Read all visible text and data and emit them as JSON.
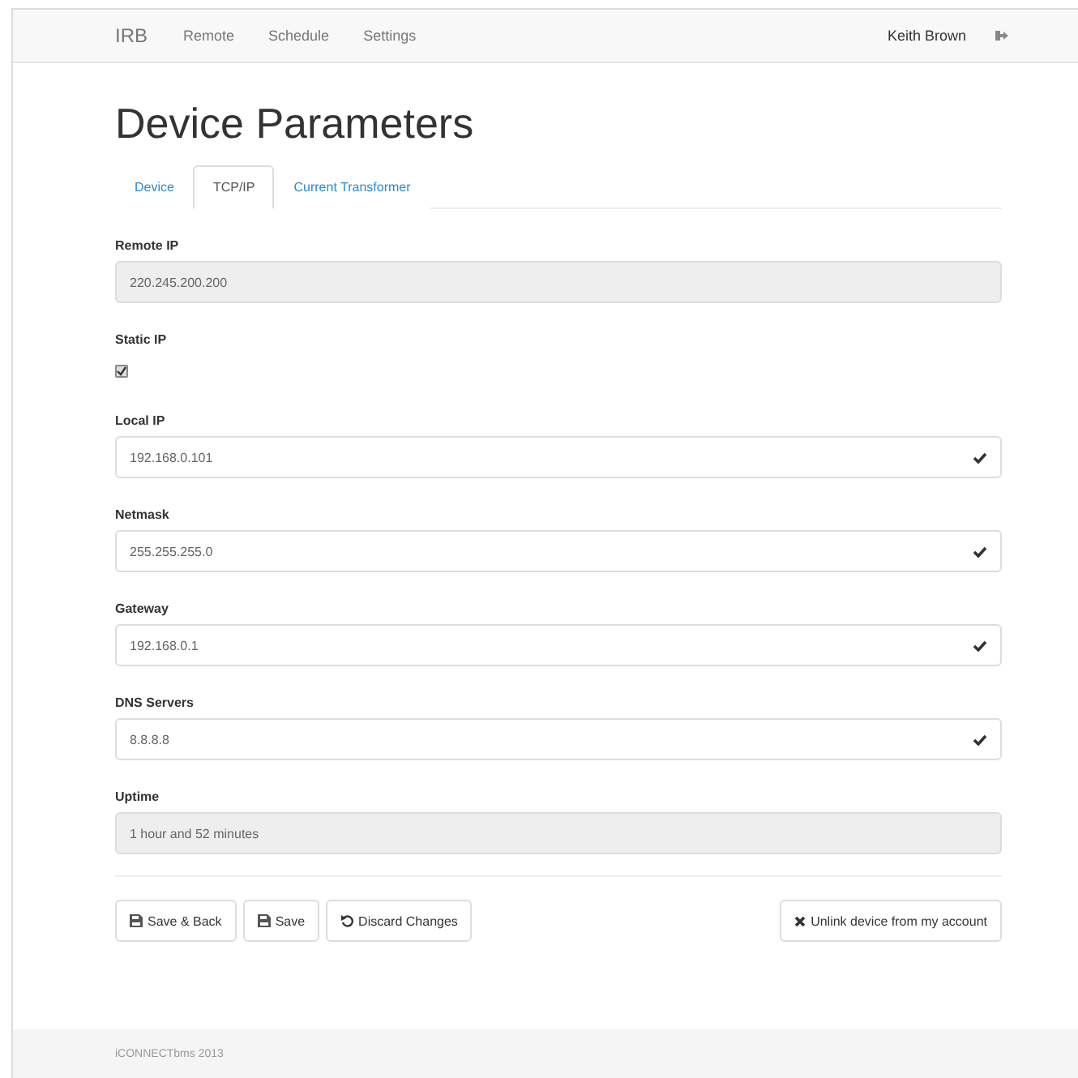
{
  "navbar": {
    "brand": "IRB",
    "links": [
      "Remote",
      "Schedule",
      "Settings"
    ],
    "user": "Keith Brown"
  },
  "title": "Device Parameters",
  "tabs": [
    {
      "label": "Device",
      "selected": false
    },
    {
      "label": "TCP/IP",
      "selected": true
    },
    {
      "label": "Current Transformer",
      "selected": false
    }
  ],
  "fields": [
    {
      "kind": "readonly",
      "label": "Remote IP",
      "value": "220.245.200.200"
    },
    {
      "kind": "checkbox",
      "label": "Static IP",
      "checked": true
    },
    {
      "kind": "valid",
      "label": "Local IP",
      "value": "192.168.0.101"
    },
    {
      "kind": "valid",
      "label": "Netmask",
      "value": "255.255.255.0"
    },
    {
      "kind": "valid",
      "label": "Gateway",
      "value": "192.168.0.1"
    },
    {
      "kind": "valid",
      "label": "DNS Servers",
      "value": "8.8.8.8"
    },
    {
      "kind": "readonly",
      "label": "Uptime",
      "value": "1 hour and 52 minutes"
    }
  ],
  "buttons": [
    {
      "kind": "save",
      "label": "Save & Back"
    },
    {
      "kind": "save",
      "label": "Save"
    },
    {
      "kind": "undo",
      "label": "Discard Changes"
    }
  ],
  "unlink_button": "Unlink device from my account",
  "footer": "iCONNECTbms 2013"
}
